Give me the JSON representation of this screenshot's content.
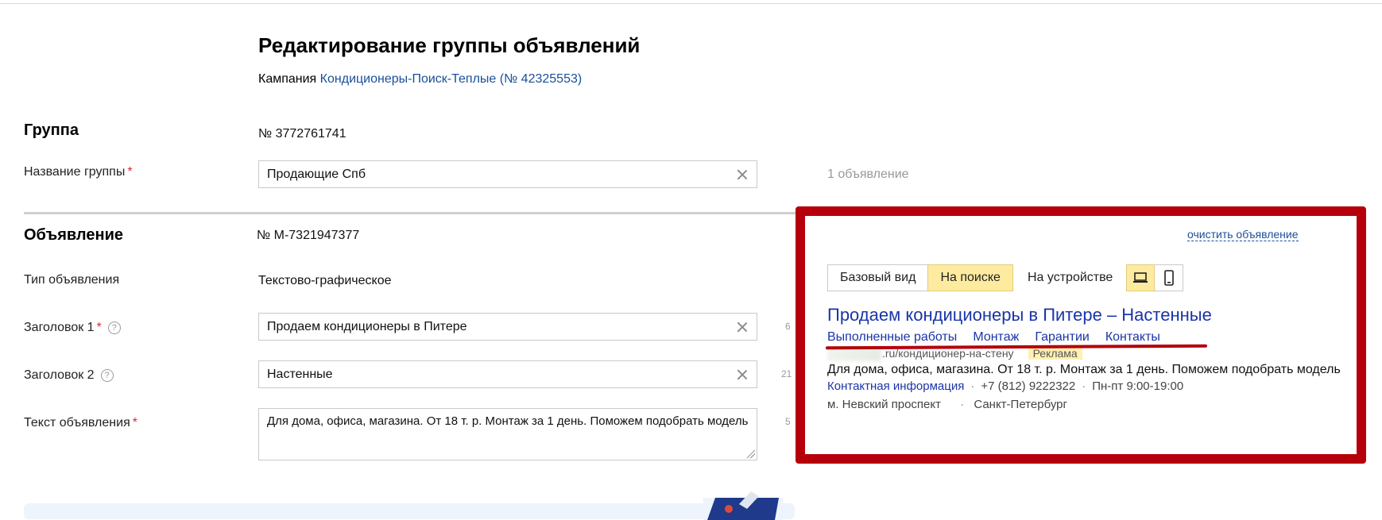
{
  "page": {
    "title": "Редактирование группы объявлений",
    "campaign_prefix": "Кампания",
    "campaign_link": "Кондиционеры-Поиск-Теплые (№ 42325553)"
  },
  "group": {
    "section_title": "Группа",
    "number": "№ 3772761741",
    "name_label": "Название группы",
    "name_value": "Продающие Спб",
    "ads_count": "1 объявление"
  },
  "ad": {
    "section_title": "Объявление",
    "number": "№ M-7321947377",
    "type_label": "Тип объявления",
    "type_value": "Текстово-графическое",
    "title1_label": "Заголовок 1",
    "title1_value": "Продаем кондиционеры в Питере",
    "title1_counter": "6",
    "title2_label": "Заголовок 2",
    "title2_value": "Настенные",
    "title2_counter": "21",
    "text_label": "Текст объявления",
    "text_value": "Для дома, офиса, магазина. От 18 т. р. Монтаж за 1 день. Поможем подобрать модель",
    "text_counter": "5"
  },
  "preview": {
    "clear_link": "очистить объявление",
    "view_tabs": [
      "Базовый вид",
      "На поиске"
    ],
    "active_view": "На поиске",
    "device_label": "На устройстве",
    "devices": [
      "laptop-icon",
      "phone-icon"
    ],
    "ad_title": "Продаем кондиционеры в Питере – Настенные",
    "sitelinks": [
      "Выполненные работы",
      "Монтаж",
      "Гарантии",
      "Контакты"
    ],
    "url_path": ".ru/кондиционер-на-стену",
    "ad_badge": "Реклама",
    "ad_text": "Для дома, офиса, магазина. От 18 т. р. Монтаж за 1 день. Поможем подобрать модель",
    "contact_link": "Контактная информация",
    "phone": "+7 (812) 9222322",
    "hours": "Пн-пт 9:00-19:00",
    "metro": "м. Невский проспект",
    "city": "Санкт-Петербург"
  },
  "colors": {
    "link": "#1a4f99",
    "ad_link": "#1a35a8",
    "active_tab": "#ffeba0",
    "highlight": "#b5000b",
    "required": "#e0253a"
  }
}
